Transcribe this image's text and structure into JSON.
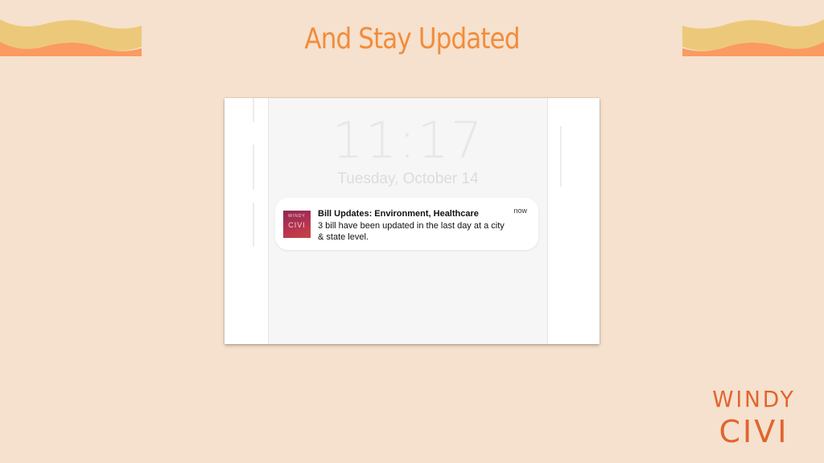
{
  "colors": {
    "background": "#f5e1cd",
    "heading": "#f28c3c",
    "wave_yellow": "#ecc97a",
    "wave_orange": "#fb9a61",
    "brand": "#e2642f"
  },
  "slide": {
    "heading": "And Stay Updated"
  },
  "lockscreen": {
    "time": "11:17",
    "date": "Tuesday, October 14"
  },
  "notification": {
    "app_icon": {
      "name": "windy-civi-app-icon",
      "top_text": "WINDY",
      "bottom_text": "CIVI"
    },
    "title": "Bill Updates: Environment, Healthcare",
    "body": "3 bill have been updated in the last day at a city & state level.",
    "time": "now"
  },
  "brand": {
    "line1": "WINDY",
    "line2": "CIVI"
  }
}
